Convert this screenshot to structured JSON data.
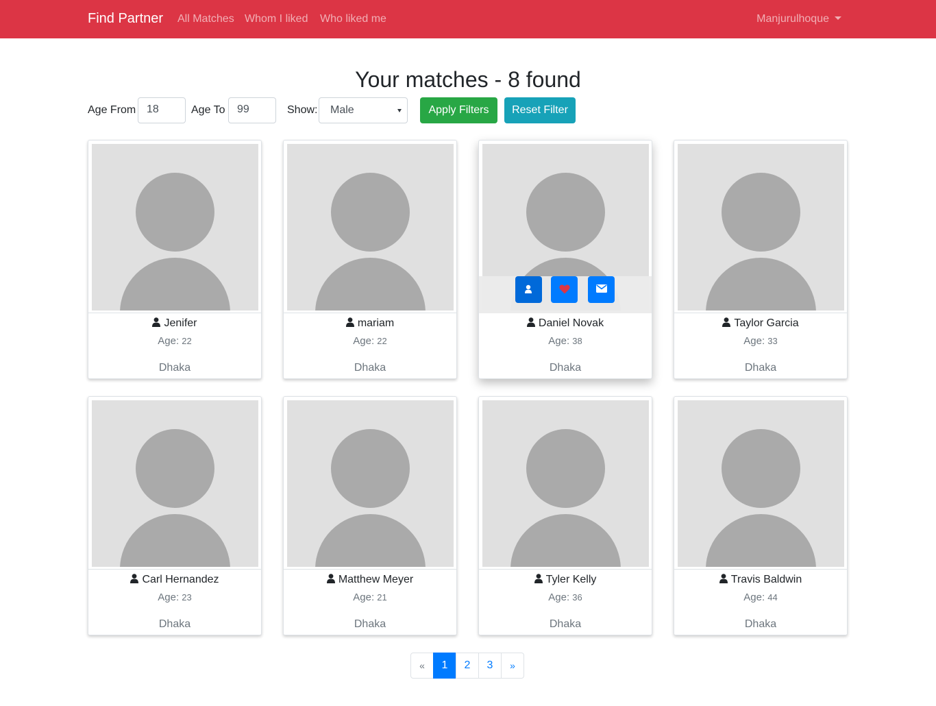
{
  "navbar": {
    "brand": "Find Partner",
    "links": [
      "All Matches",
      "Whom I liked",
      "Who liked me"
    ],
    "user": "Manjurulhoque",
    "color": "#dc3545"
  },
  "title": "Your matches - 8 found",
  "filters": {
    "age_from_label": "Age From",
    "age_from_value": "18",
    "age_to_label": "Age To",
    "age_to_value": "99",
    "show_label": "Show:",
    "show_value": "Male",
    "apply_label": "Apply Filters",
    "reset_label": "Reset Filter"
  },
  "matches": [
    {
      "name": "Jenifer",
      "age_label": "Age:",
      "age": "22",
      "city": "Dhaka"
    },
    {
      "name": "mariam",
      "age_label": "Age:",
      "age": "22",
      "city": "Dhaka"
    },
    {
      "name": "Daniel Novak",
      "age_label": "Age:",
      "age": "38",
      "city": "Dhaka"
    },
    {
      "name": "Taylor Garcia",
      "age_label": "Age:",
      "age": "33",
      "city": "Dhaka"
    },
    {
      "name": "Carl Hernandez",
      "age_label": "Age:",
      "age": "23",
      "city": "Dhaka"
    },
    {
      "name": "Matthew Meyer",
      "age_label": "Age:",
      "age": "21",
      "city": "Dhaka"
    },
    {
      "name": "Tyler Kelly",
      "age_label": "Age:",
      "age": "36",
      "city": "Dhaka"
    },
    {
      "name": "Travis Baldwin",
      "age_label": "Age:",
      "age": "44",
      "city": "Dhaka"
    }
  ],
  "card_actions": {
    "icons": [
      "user-icon",
      "heart-icon",
      "envelope-icon"
    ]
  },
  "pagination": {
    "prev": "«",
    "pages": [
      "1",
      "2",
      "3"
    ],
    "next": "»",
    "active_page": "1"
  }
}
